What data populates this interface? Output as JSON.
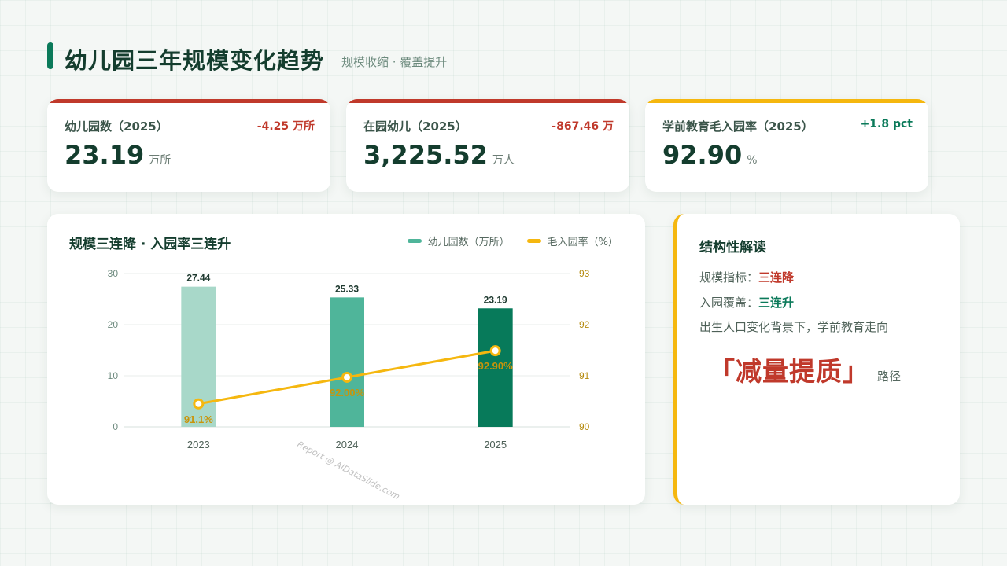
{
  "header": {
    "title": "幼儿园三年规模变化趋势",
    "subtitle": "规模收缩 · 覆盖提升"
  },
  "kpis": [
    {
      "label": "幼儿园数（2025）",
      "delta": "-4.25 万所",
      "value": "23.19",
      "unit": "万所",
      "accent": "#c0392b",
      "delta_color": "#c0392b"
    },
    {
      "label": "在园幼儿（2025）",
      "delta": "-867.46 万",
      "value": "3,225.52",
      "unit": "万人",
      "accent": "#c0392b",
      "delta_color": "#c0392b"
    },
    {
      "label": "学前教育毛入园率（2025）",
      "delta": "+1.8 pct",
      "value": "92.90",
      "unit": "%",
      "accent": "#f5b70f",
      "delta_color": "#0b7a5a"
    }
  ],
  "chart": {
    "title": "规模三连降 · 入园率三连升",
    "legend": [
      {
        "label": "幼儿园数（万所）",
        "color": "#4fb59a"
      },
      {
        "label": "毛入园率（%）",
        "color": "#f5b70f"
      }
    ],
    "watermark": "Report @ AIDataSlide.com"
  },
  "chart_data": {
    "type": "bar",
    "categories": [
      "2023",
      "2024",
      "2025"
    ],
    "series": [
      {
        "name": "幼儿园数（万所）",
        "type": "bar",
        "axis": "left",
        "values": [
          27.44,
          25.33,
          23.19
        ],
        "labels": [
          "27.44",
          "25.33",
          "23.19"
        ],
        "colors": [
          "#a8d8c9",
          "#4fb59a",
          "#077a5a"
        ]
      },
      {
        "name": "毛入园率（%）",
        "type": "line",
        "axis": "right",
        "values": [
          90.45,
          90.97,
          91.49
        ],
        "labels": [
          "91.1%",
          "92.00%",
          "92.90%"
        ],
        "color": "#f5b70f"
      }
    ],
    "y_left": {
      "min": 0,
      "max": 30,
      "ticks": [
        0,
        10,
        20,
        30
      ]
    },
    "y_right": {
      "min": 90,
      "max": 93,
      "ticks": [
        90,
        91,
        92,
        93
      ]
    },
    "grid": true,
    "legend_position": "top-right"
  },
  "insight": {
    "title": "结构性解读",
    "line1_prefix": "规模指标：",
    "line1_emph": "三连降",
    "line2_prefix": "入园覆盖：",
    "line2_emph": "三连升",
    "line3": "出生人口变化背景下，学前教育走向",
    "big": "「减量提质」",
    "suffix": "路径"
  },
  "colors": {
    "primary_green": "#0b7a5a",
    "alert_red": "#c0392b",
    "accent_yellow": "#f5b70f"
  }
}
